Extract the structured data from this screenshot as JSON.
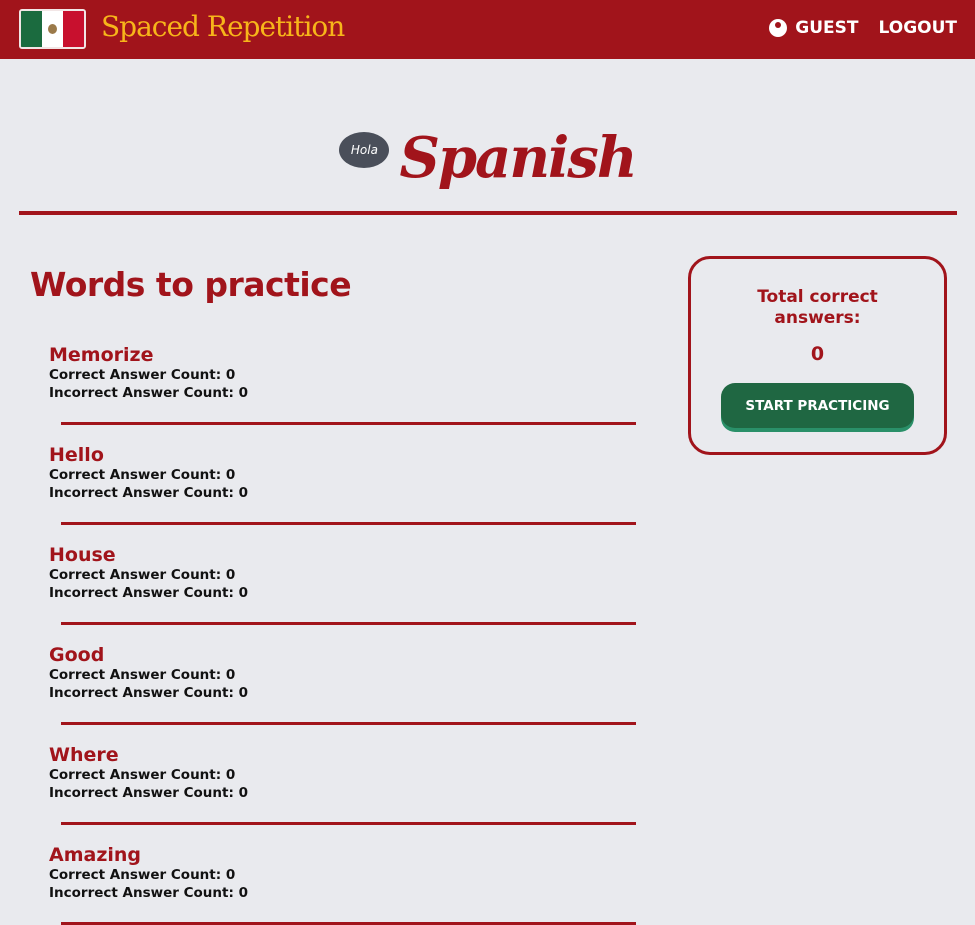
{
  "nav": {
    "brand": "Spaced Repetition",
    "user": "GUEST",
    "logout": "LOGOUT"
  },
  "hero": {
    "badge": "Hola",
    "language": "Spanish"
  },
  "main": {
    "title": "Words to practice",
    "words": [
      {
        "word": "Memorize",
        "correct": "Correct Answer Count: 0",
        "incorrect": "Incorrect Answer Count: 0"
      },
      {
        "word": "Hello",
        "correct": "Correct Answer Count: 0",
        "incorrect": "Incorrect Answer Count: 0"
      },
      {
        "word": "House",
        "correct": "Correct Answer Count: 0",
        "incorrect": "Incorrect Answer Count: 0"
      },
      {
        "word": "Good",
        "correct": "Correct Answer Count: 0",
        "incorrect": "Incorrect Answer Count: 0"
      },
      {
        "word": "Where",
        "correct": "Correct Answer Count: 0",
        "incorrect": "Incorrect Answer Count: 0"
      },
      {
        "word": "Amazing",
        "correct": "Correct Answer Count: 0",
        "incorrect": "Incorrect Answer Count: 0"
      }
    ]
  },
  "summary": {
    "label": "Total correct answers:",
    "total": "0",
    "button": "START PRACTICING"
  },
  "colors": {
    "primary": "#a1141b",
    "brand": "#f7b51a",
    "button": "#1f6742",
    "background": "#e9eaee"
  }
}
